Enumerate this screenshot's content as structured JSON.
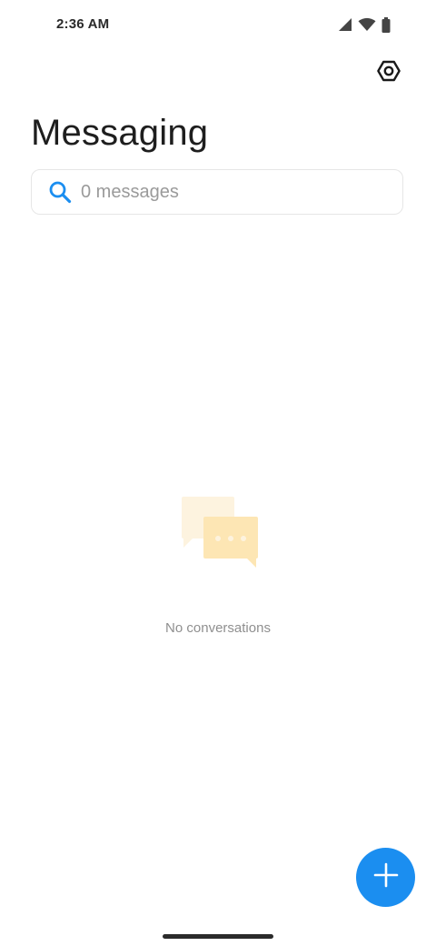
{
  "status_bar": {
    "time": "2:36 AM",
    "icons": [
      "cellular-signal-icon",
      "wifi-icon",
      "battery-icon"
    ]
  },
  "header": {
    "title": "Messaging",
    "settings_icon": "settings-gear-icon"
  },
  "search": {
    "placeholder": "0 messages",
    "value": "",
    "icon": "search-icon"
  },
  "empty_state": {
    "icon": "chat-bubbles-icon",
    "text": "No conversations"
  },
  "fab": {
    "icon": "plus-icon",
    "color": "#1b8ef0"
  },
  "colors": {
    "accent": "#1b8ef0",
    "illustration_back": "#fdf3df",
    "illustration_front": "#fde6b4"
  }
}
